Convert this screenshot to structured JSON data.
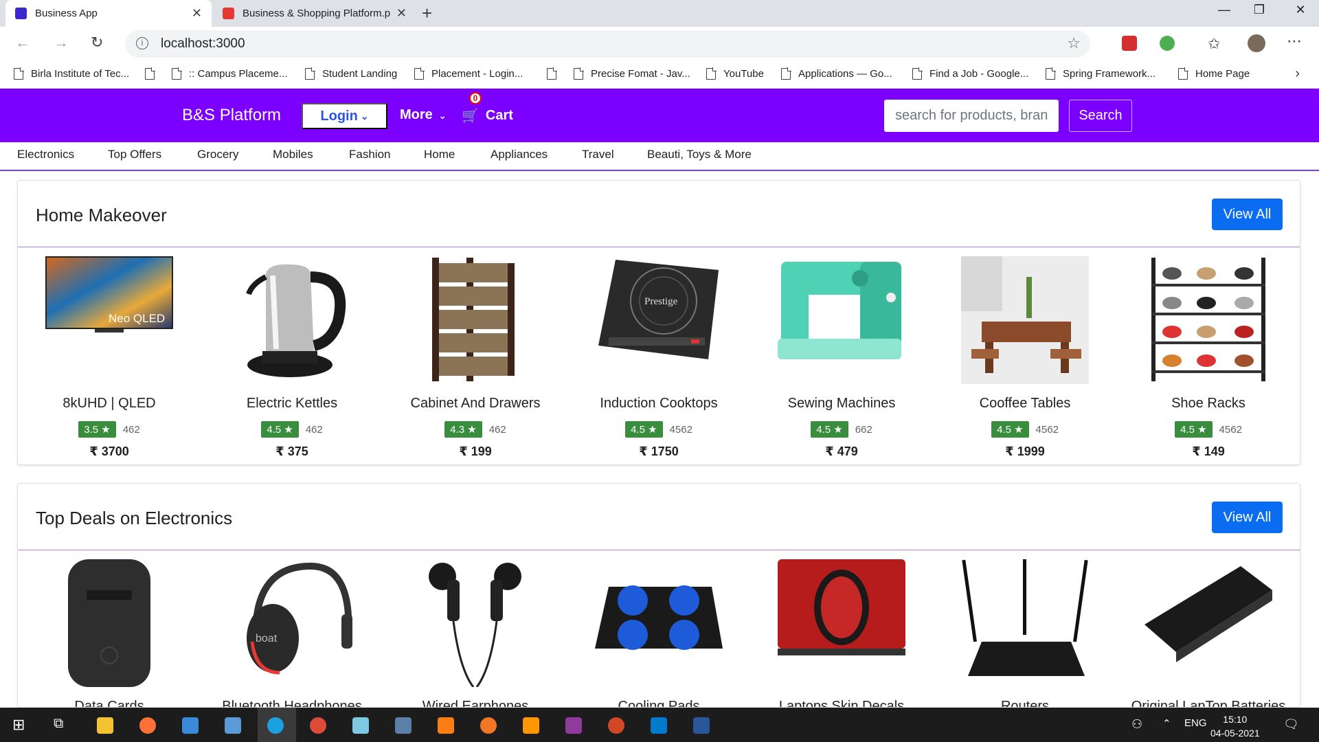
{
  "browser": {
    "tabs": [
      {
        "title": "Business App",
        "favicon_color": "#3b28cc"
      },
      {
        "title": "Business & Shopping Platform.p",
        "favicon_color": "#e53935"
      }
    ],
    "url": "localhost:3000",
    "bookmarks": [
      "Birla Institute of Tec...",
      "",
      ":: Campus Placeme...",
      "Student Landing",
      "Placement - Login...",
      "",
      "Precise Fomat - Jav...",
      "YouTube",
      "Applications — Go...",
      "Find a Job - Google...",
      "Spring Framework...",
      "Home Page"
    ]
  },
  "header": {
    "brand": "B&S Platform",
    "login_label": "Login",
    "more_label": "More",
    "cart_label": "Cart",
    "cart_count": "0",
    "search_placeholder": "search for products, brands and more",
    "search_label": "Search",
    "brand_color": "#7b00ff"
  },
  "categories": [
    "Electronics",
    "Top Offers",
    "Grocery",
    "Mobiles",
    "Fashion",
    "Home",
    "Appliances",
    "Travel",
    "Beauti, Toys & More"
  ],
  "sections": [
    {
      "title": "Home Makeover",
      "view_all": "View All",
      "items": [
        {
          "name": "8kUHD | QLED",
          "rating": "3.5 ★",
          "votes": "462",
          "price": "₹ 3700",
          "icon": "tv-icon"
        },
        {
          "name": "Electric Kettles",
          "rating": "4.5 ★",
          "votes": "462",
          "price": "₹ 375",
          "icon": "kettle-icon"
        },
        {
          "name": "Cabinet And Drawers",
          "rating": "4.3 ★",
          "votes": "462",
          "price": "₹ 199",
          "icon": "cabinet-icon"
        },
        {
          "name": "Induction Cooktops",
          "rating": "4.5 ★",
          "votes": "4562",
          "price": "₹ 1750",
          "icon": "cooktop-icon"
        },
        {
          "name": "Sewing Machines",
          "rating": "4.5 ★",
          "votes": "662",
          "price": "₹ 479",
          "icon": "sewing-machine-icon"
        },
        {
          "name": "Cooffee Tables",
          "rating": "4.5 ★",
          "votes": "4562",
          "price": "₹ 1999",
          "icon": "table-icon"
        },
        {
          "name": "Shoe Racks",
          "rating": "4.5 ★",
          "votes": "4562",
          "price": "₹ 149",
          "icon": "shoe-rack-icon"
        }
      ]
    },
    {
      "title": "Top Deals on Electronics",
      "view_all": "View All",
      "items": [
        {
          "name": "Data Cards",
          "icon": "data-card-icon"
        },
        {
          "name": "Bluetooth Headphones",
          "icon": "headphones-icon"
        },
        {
          "name": "Wired Earphones",
          "icon": "earphones-icon"
        },
        {
          "name": "Cooling Pads",
          "icon": "cooling-pad-icon"
        },
        {
          "name": "Laptops Skin Decals",
          "icon": "laptop-skin-icon"
        },
        {
          "name": "Routers",
          "icon": "router-icon"
        },
        {
          "name": "Original LapTop Batteries",
          "icon": "battery-icon"
        }
      ]
    }
  ],
  "taskbar": {
    "language": "ENG",
    "time": "15:10",
    "date": "04-05-2021"
  }
}
